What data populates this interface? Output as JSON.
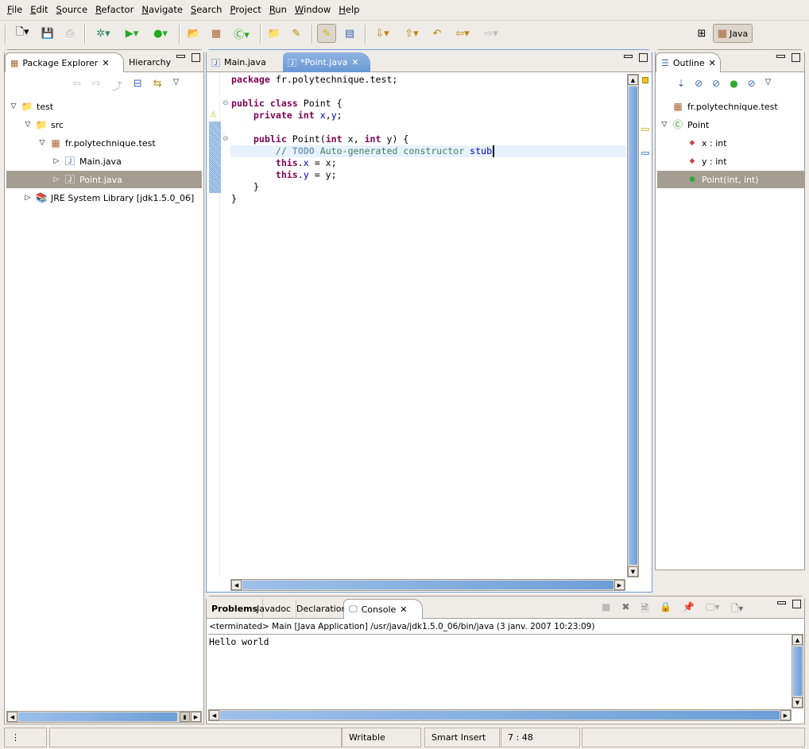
{
  "menu": [
    "File",
    "Edit",
    "Source",
    "Refactor",
    "Navigate",
    "Search",
    "Project",
    "Run",
    "Window",
    "Help"
  ],
  "perspective": {
    "label": "Java"
  },
  "package_explorer": {
    "tabs": [
      "Package Explorer",
      "Hierarchy"
    ],
    "tree": [
      {
        "label": "test",
        "level": 0,
        "open": true
      },
      {
        "label": "src",
        "level": 1,
        "open": true
      },
      {
        "label": "fr.polytechnique.test",
        "level": 2,
        "open": true
      },
      {
        "label": "Main.java",
        "level": 3,
        "open": false
      },
      {
        "label": "Point.java",
        "level": 3,
        "open": false,
        "selected": true
      },
      {
        "label": "JRE System Library [jdk1.5.0_06]",
        "level": 1,
        "open": false
      }
    ]
  },
  "editor": {
    "tabs": [
      "Main.java",
      "*Point.java"
    ],
    "lines": [
      [
        [
          "package",
          "kw"
        ],
        [
          " fr.polytechnique.test;",
          ""
        ]
      ],
      [],
      [
        [
          "public",
          "kw"
        ],
        [
          " ",
          ""
        ],
        [
          "class",
          "kw"
        ],
        [
          " Point {",
          ""
        ]
      ],
      [
        [
          "    ",
          ""
        ],
        [
          "private",
          "kw"
        ],
        [
          " ",
          ""
        ],
        [
          "int",
          "kw"
        ],
        [
          " ",
          ""
        ],
        [
          "x",
          "fld"
        ],
        [
          ",",
          ""
        ],
        [
          "y",
          "fld"
        ],
        [
          ";",
          ""
        ]
      ],
      [],
      [
        [
          "    ",
          ""
        ],
        [
          "public",
          "kw"
        ],
        [
          " Point(",
          ""
        ],
        [
          "int",
          "kw"
        ],
        [
          " x, ",
          ""
        ],
        [
          "int",
          "kw"
        ],
        [
          " y) {",
          ""
        ]
      ],
      [
        [
          "        ",
          ""
        ],
        [
          "// ",
          "cm"
        ],
        [
          "TODO",
          "todo"
        ],
        [
          " Auto-generated constructor ",
          "cm"
        ],
        [
          "stub",
          "fld"
        ]
      ],
      [
        [
          "        ",
          ""
        ],
        [
          "this",
          "kw"
        ],
        [
          ".",
          ""
        ],
        [
          "x",
          "fld"
        ],
        [
          " = x;",
          ""
        ]
      ],
      [
        [
          "        ",
          ""
        ],
        [
          "this",
          "kw"
        ],
        [
          ".",
          ""
        ],
        [
          "y",
          "fld"
        ],
        [
          " = y;",
          ""
        ]
      ],
      [
        [
          "    }",
          ""
        ]
      ],
      [
        [
          "}",
          ""
        ]
      ]
    ]
  },
  "outline": {
    "title": "Outline",
    "items": [
      {
        "label": "fr.polytechnique.test",
        "level": 0
      },
      {
        "label": "Point",
        "level": 0,
        "open": true
      },
      {
        "label": "x : int",
        "level": 1
      },
      {
        "label": "y : int",
        "level": 1
      },
      {
        "label": "Point(int, int)",
        "level": 1,
        "selected": true
      }
    ]
  },
  "bottom": {
    "tabs": [
      "Problems",
      "Javadoc",
      "Declaration",
      "Console"
    ],
    "console_header": "<terminated> Main [Java Application] /usr/java/jdk1.5.0_06/bin/java (3 janv. 2007 10:23:09)",
    "output": "Hello world"
  },
  "status": {
    "writable": "Writable",
    "insert_mode": "Smart Insert",
    "position": "7 : 48"
  }
}
